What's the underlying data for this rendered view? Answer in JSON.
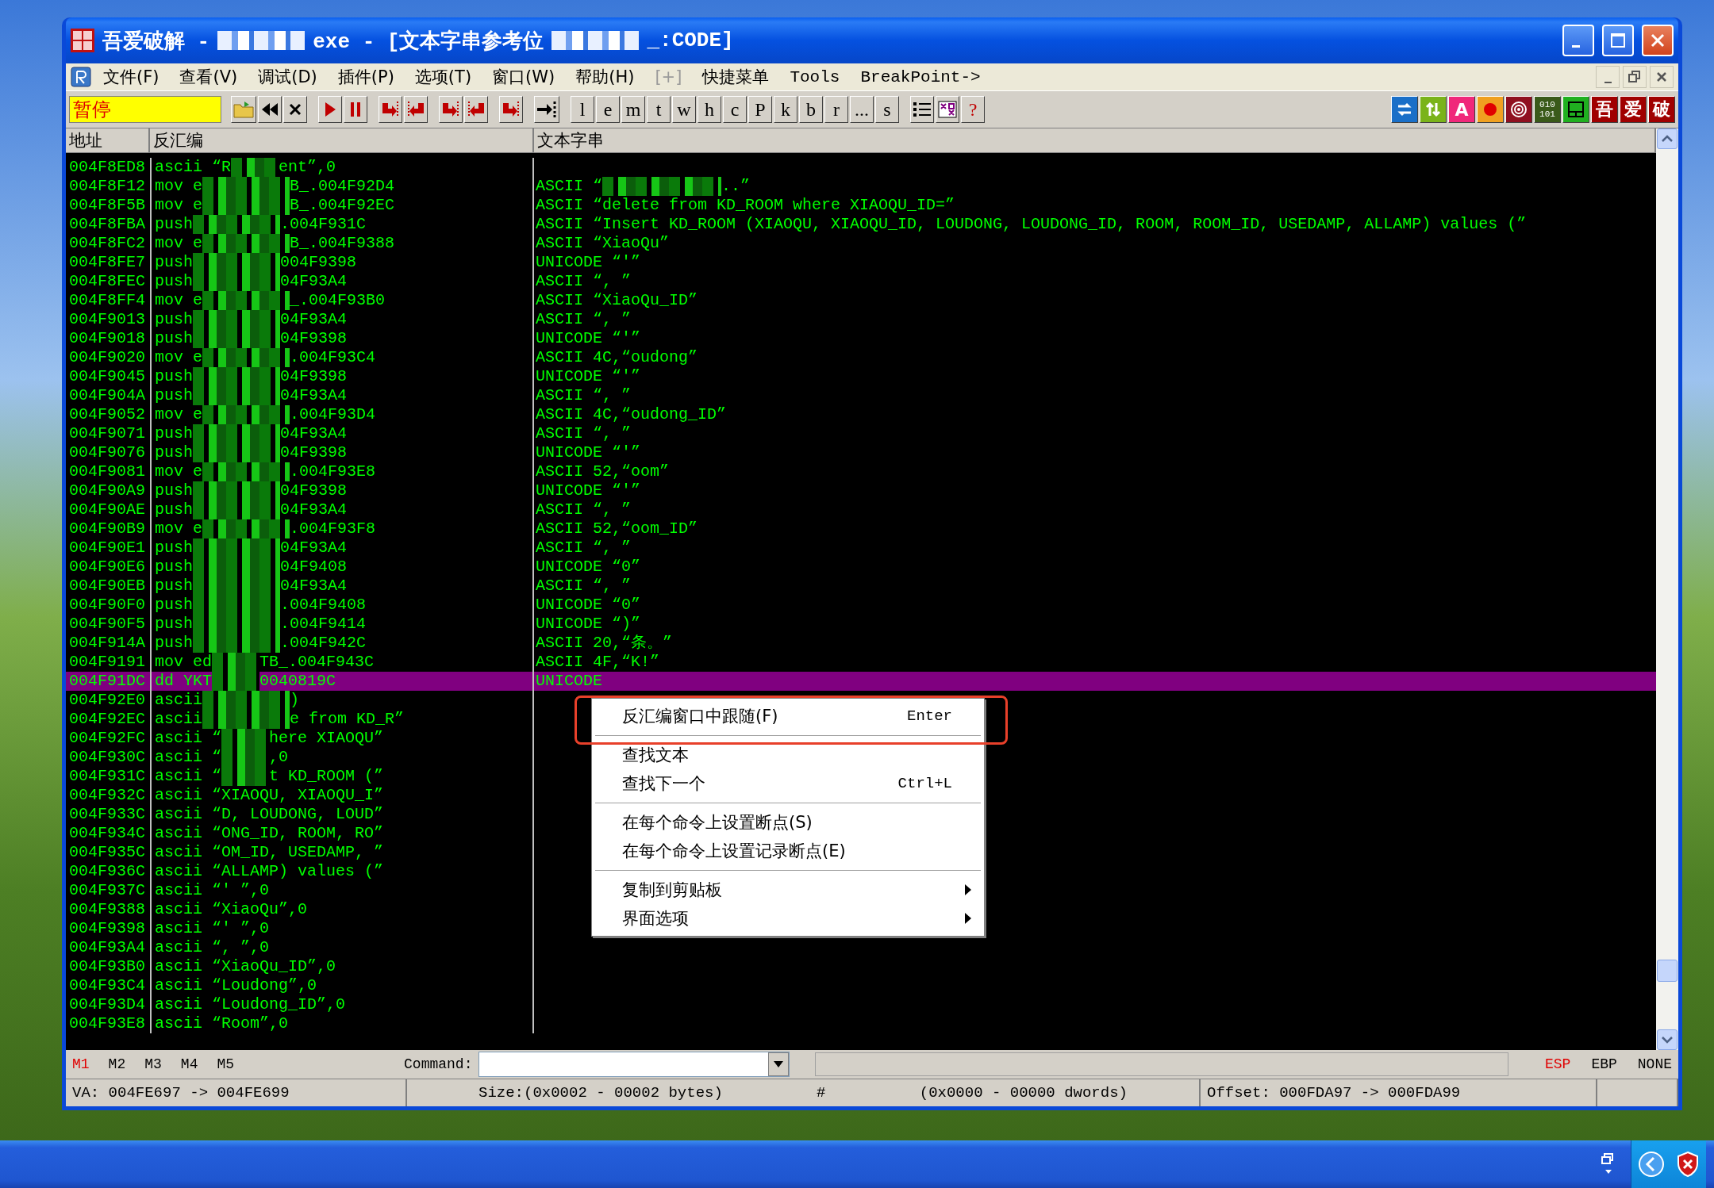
{
  "window": {
    "title_parts": [
      "吾爱破解 -",
      "exe - [文本字串参考位",
      "_:CODE]"
    ]
  },
  "menu": [
    {
      "label": "文件(F)",
      "disabled": false
    },
    {
      "label": "查看(V)",
      "disabled": false
    },
    {
      "label": "调试(D)",
      "disabled": false
    },
    {
      "label": "插件(P)",
      "disabled": false
    },
    {
      "label": "选项(T)",
      "disabled": false
    },
    {
      "label": "窗口(W)",
      "disabled": false
    },
    {
      "label": "帮助(H)",
      "disabled": false
    },
    {
      "label": "[+]",
      "disabled": true
    },
    {
      "label": "快捷菜单",
      "disabled": false
    },
    {
      "label": "Tools",
      "disabled": false
    },
    {
      "label": "BreakPoint->",
      "disabled": false
    }
  ],
  "toolbar": {
    "status": "暂停",
    "left_tools": [
      {
        "kind": "open"
      },
      {
        "kind": "rewind"
      },
      {
        "kind": "close"
      },
      {
        "kind": "run"
      },
      {
        "kind": "pause"
      },
      {
        "kind": "step-into"
      },
      {
        "kind": "step-over"
      },
      {
        "kind": "trace-into"
      },
      {
        "kind": "trace-over"
      },
      {
        "kind": "return"
      },
      {
        "kind": "goto"
      }
    ],
    "letters": [
      "l",
      "e",
      "m",
      "t",
      "w",
      "h",
      "c",
      "P",
      "k",
      "b",
      "r",
      "...",
      "s"
    ],
    "view_tools": [
      {
        "kind": "list"
      },
      {
        "kind": "grid"
      },
      {
        "kind": "help",
        "text": "?"
      }
    ],
    "right_tools": [
      {
        "kind": "swap"
      },
      {
        "kind": "updown"
      },
      {
        "kind": "letter",
        "text": "A"
      },
      {
        "kind": "record"
      },
      {
        "kind": "target"
      },
      {
        "kind": "binary",
        "lines": [
          "010",
          "101"
        ]
      },
      {
        "kind": "panel"
      },
      {
        "kind": "char",
        "text": "吾"
      },
      {
        "kind": "char",
        "text": "爱"
      },
      {
        "kind": "char",
        "text": "破"
      }
    ]
  },
  "columns": [
    "地址",
    "反汇编",
    "文本字串"
  ],
  "rows": [
    {
      "address": "004F8ED8",
      "disasm": [
        "ascii “R",
        "ent”,0"
      ],
      "selected": false
    },
    {
      "address": "004F8F12",
      "disasm": [
        "mov e",
        "B_.004F92D4"
      ],
      "text": [
        "ASCII “",
        "..”"
      ],
      "selected": false
    },
    {
      "address": "004F8F5B",
      "disasm": [
        "mov e",
        "B_.004F92EC"
      ],
      "text": [
        "ASCII “delete from KD_ROOM where XIAOQU_ID=”"
      ],
      "selected": false
    },
    {
      "address": "004F8FBA",
      "disasm": [
        "push",
        ".004F931C"
      ],
      "text": [
        "ASCII “Insert KD_ROOM (XIAOQU, XIAOQU_ID, LOUDONG, LOUDONG_ID, ROOM, ROOM_ID, USEDAMP, ALLAMP) values (”"
      ],
      "selected": false
    },
    {
      "address": "004F8FC2",
      "disasm": [
        "mov e",
        "B_.004F9388"
      ],
      "text": [
        "ASCII “XiaoQu”"
      ],
      "selected": false
    },
    {
      "address": "004F8FE7",
      "disasm": [
        "push",
        "004F9398"
      ],
      "text": [
        "UNICODE “'”"
      ],
      "selected": false
    },
    {
      "address": "004F8FEC",
      "disasm": [
        "push",
        "04F93A4"
      ],
      "text": [
        "ASCII “, ”"
      ],
      "selected": false
    },
    {
      "address": "004F8FF4",
      "disasm": [
        "mov e",
        "_.004F93B0"
      ],
      "text": [
        "ASCII “XiaoQu_ID”"
      ],
      "selected": false
    },
    {
      "address": "004F9013",
      "disasm": [
        "push",
        "04F93A4"
      ],
      "text": [
        "ASCII “, ”"
      ],
      "selected": false
    },
    {
      "address": "004F9018",
      "disasm": [
        "push",
        "04F9398"
      ],
      "text": [
        "UNICODE “'”"
      ],
      "selected": false
    },
    {
      "address": "004F9020",
      "disasm": [
        "mov e",
        ".004F93C4"
      ],
      "text": [
        "ASCII 4C,“oudong”"
      ],
      "selected": false
    },
    {
      "address": "004F9045",
      "disasm": [
        "push",
        "04F9398"
      ],
      "text": [
        "UNICODE “'”"
      ],
      "selected": false
    },
    {
      "address": "004F904A",
      "disasm": [
        "push",
        "04F93A4"
      ],
      "text": [
        "ASCII “, ”"
      ],
      "selected": false
    },
    {
      "address": "004F9052",
      "disasm": [
        "mov e",
        ".004F93D4"
      ],
      "text": [
        "ASCII 4C,“oudong_ID”"
      ],
      "selected": false
    },
    {
      "address": "004F9071",
      "disasm": [
        "push",
        "04F93A4"
      ],
      "text": [
        "ASCII “, ”"
      ],
      "selected": false
    },
    {
      "address": "004F9076",
      "disasm": [
        "push",
        "04F9398"
      ],
      "text": [
        "UNICODE “'”"
      ],
      "selected": false
    },
    {
      "address": "004F9081",
      "disasm": [
        "mov e",
        ".004F93E8"
      ],
      "text": [
        "ASCII 52,“oom”"
      ],
      "selected": false
    },
    {
      "address": "004F90A9",
      "disasm": [
        "push",
        "04F9398"
      ],
      "text": [
        "UNICODE “'”"
      ],
      "selected": false
    },
    {
      "address": "004F90AE",
      "disasm": [
        "push",
        "04F93A4"
      ],
      "text": [
        "ASCII “, ”"
      ],
      "selected": false
    },
    {
      "address": "004F90B9",
      "disasm": [
        "mov e",
        ".004F93F8"
      ],
      "text": [
        "ASCII 52,“oom_ID”"
      ],
      "selected": false
    },
    {
      "address": "004F90E1",
      "disasm": [
        "push",
        "04F93A4"
      ],
      "text": [
        "ASCII “, ”"
      ],
      "selected": false
    },
    {
      "address": "004F90E6",
      "disasm": [
        "push",
        "04F9408"
      ],
      "text": [
        "UNICODE “0”"
      ],
      "selected": false
    },
    {
      "address": "004F90EB",
      "disasm": [
        "push",
        "04F93A4"
      ],
      "text": [
        "ASCII “, ”"
      ],
      "selected": false
    },
    {
      "address": "004F90F0",
      "disasm": [
        "push",
        ".004F9408"
      ],
      "text": [
        "UNICODE “0”"
      ],
      "selected": false
    },
    {
      "address": "004F90F5",
      "disasm": [
        "push",
        ".004F9414"
      ],
      "text": [
        "UNICODE “)”"
      ],
      "selected": false
    },
    {
      "address": "004F914A",
      "disasm": [
        "push",
        ".004F942C"
      ],
      "text": [
        "ASCII 20,“条。”"
      ],
      "selected": false
    },
    {
      "address": "004F9191",
      "disasm": [
        "mov ed",
        "TB_.004F943C"
      ],
      "text": [
        "ASCII 4F,“K!”"
      ],
      "selected": false
    },
    {
      "address": "004F91DC",
      "disasm": [
        "dd YKT",
        "0040819C"
      ],
      "text": [
        "UNICODE"
      ],
      "selected": true
    },
    {
      "address": "004F92E0",
      "disasm": [
        "ascii",
        ")"
      ],
      "selected": false
    },
    {
      "address": "004F92EC",
      "disasm": [
        "ascii",
        "e from KD_R”"
      ],
      "selected": false
    },
    {
      "address": "004F92FC",
      "disasm": [
        "ascii “",
        "here XIAOQU”"
      ],
      "selected": false
    },
    {
      "address": "004F930C",
      "disasm": [
        "ascii “",
        ",0"
      ],
      "selected": false
    },
    {
      "address": "004F931C",
      "disasm": [
        "ascii “",
        "t KD_ROOM (”"
      ],
      "selected": false
    },
    {
      "address": "004F932C",
      "disasm": [
        "ascii “XIAOQU, XIAOQU_I”"
      ],
      "selected": false
    },
    {
      "address": "004F933C",
      "disasm": [
        "ascii “D, LOUDONG, LOUD”"
      ],
      "selected": false
    },
    {
      "address": "004F934C",
      "disasm": [
        "ascii “ONG_ID, ROOM, RO”"
      ],
      "selected": false
    },
    {
      "address": "004F935C",
      "disasm": [
        "ascii “OM_ID, USEDAMP, ”"
      ],
      "selected": false
    },
    {
      "address": "004F936C",
      "disasm": [
        "ascii “ALLAMP) values (”"
      ],
      "selected": false
    },
    {
      "address": "004F937C",
      "disasm": [
        "ascii “' ”,0"
      ],
      "selected": false
    },
    {
      "address": "004F9388",
      "disasm": [
        "ascii “XiaoQu”,0"
      ],
      "selected": false
    },
    {
      "address": "004F9398",
      "disasm": [
        "ascii “' ”,0"
      ],
      "selected": false
    },
    {
      "address": "004F93A4",
      "disasm": [
        "ascii “, ”,0"
      ],
      "selected": false
    },
    {
      "address": "004F93B0",
      "disasm": [
        "ascii “XiaoQu_ID”,0"
      ],
      "selected": false
    },
    {
      "address": "004F93C4",
      "disasm": [
        "ascii “Loudong”,0"
      ],
      "selected": false
    },
    {
      "address": "004F93D4",
      "disasm": [
        "ascii “Loudong_ID”,0"
      ],
      "selected": false
    },
    {
      "address": "004F93E8",
      "disasm": [
        "ascii “Room”,0"
      ],
      "selected": false
    }
  ],
  "context_menu": [
    {
      "kind": "item",
      "label": "反汇编窗口中跟随(F)",
      "shortcut": "Enter",
      "highlighted": true
    },
    {
      "kind": "separator"
    },
    {
      "kind": "item",
      "label": "查找文本",
      "highlighted": false
    },
    {
      "kind": "item",
      "label": "查找下一个",
      "shortcut": "Ctrl+L",
      "highlighted": false
    },
    {
      "kind": "separator"
    },
    {
      "kind": "item",
      "label": "在每个命令上设置断点(S)",
      "highlighted": false
    },
    {
      "kind": "item",
      "label": "在每个命令上设置记录断点(E)",
      "highlighted": false
    },
    {
      "kind": "separator"
    },
    {
      "kind": "submenu",
      "label": "复制到剪贴板",
      "highlighted": false
    },
    {
      "kind": "submenu",
      "label": "界面选项",
      "highlighted": false
    }
  ],
  "bottom": {
    "marks": [
      {
        "label": "M1",
        "selected": true
      },
      {
        "label": "M2",
        "selected": false
      },
      {
        "label": "M3",
        "selected": false
      },
      {
        "label": "M4",
        "selected": false
      },
      {
        "label": "M5",
        "selected": false
      }
    ],
    "command_label": "Command:",
    "registers": [
      {
        "label": "ESP",
        "selected": true
      },
      {
        "label": "EBP",
        "selected": false
      },
      {
        "label": "NONE",
        "selected": false
      }
    ]
  },
  "status_bar": [
    [
      "VA: 004FE697 -> 004FE699"
    ],
    [
      "Size:(0x0002 - 00002 bytes)",
      "#",
      "(0x0000 - 00000 dwords)"
    ],
    [
      "Offset: 000FDA97 -> 000FDA99"
    ]
  ]
}
